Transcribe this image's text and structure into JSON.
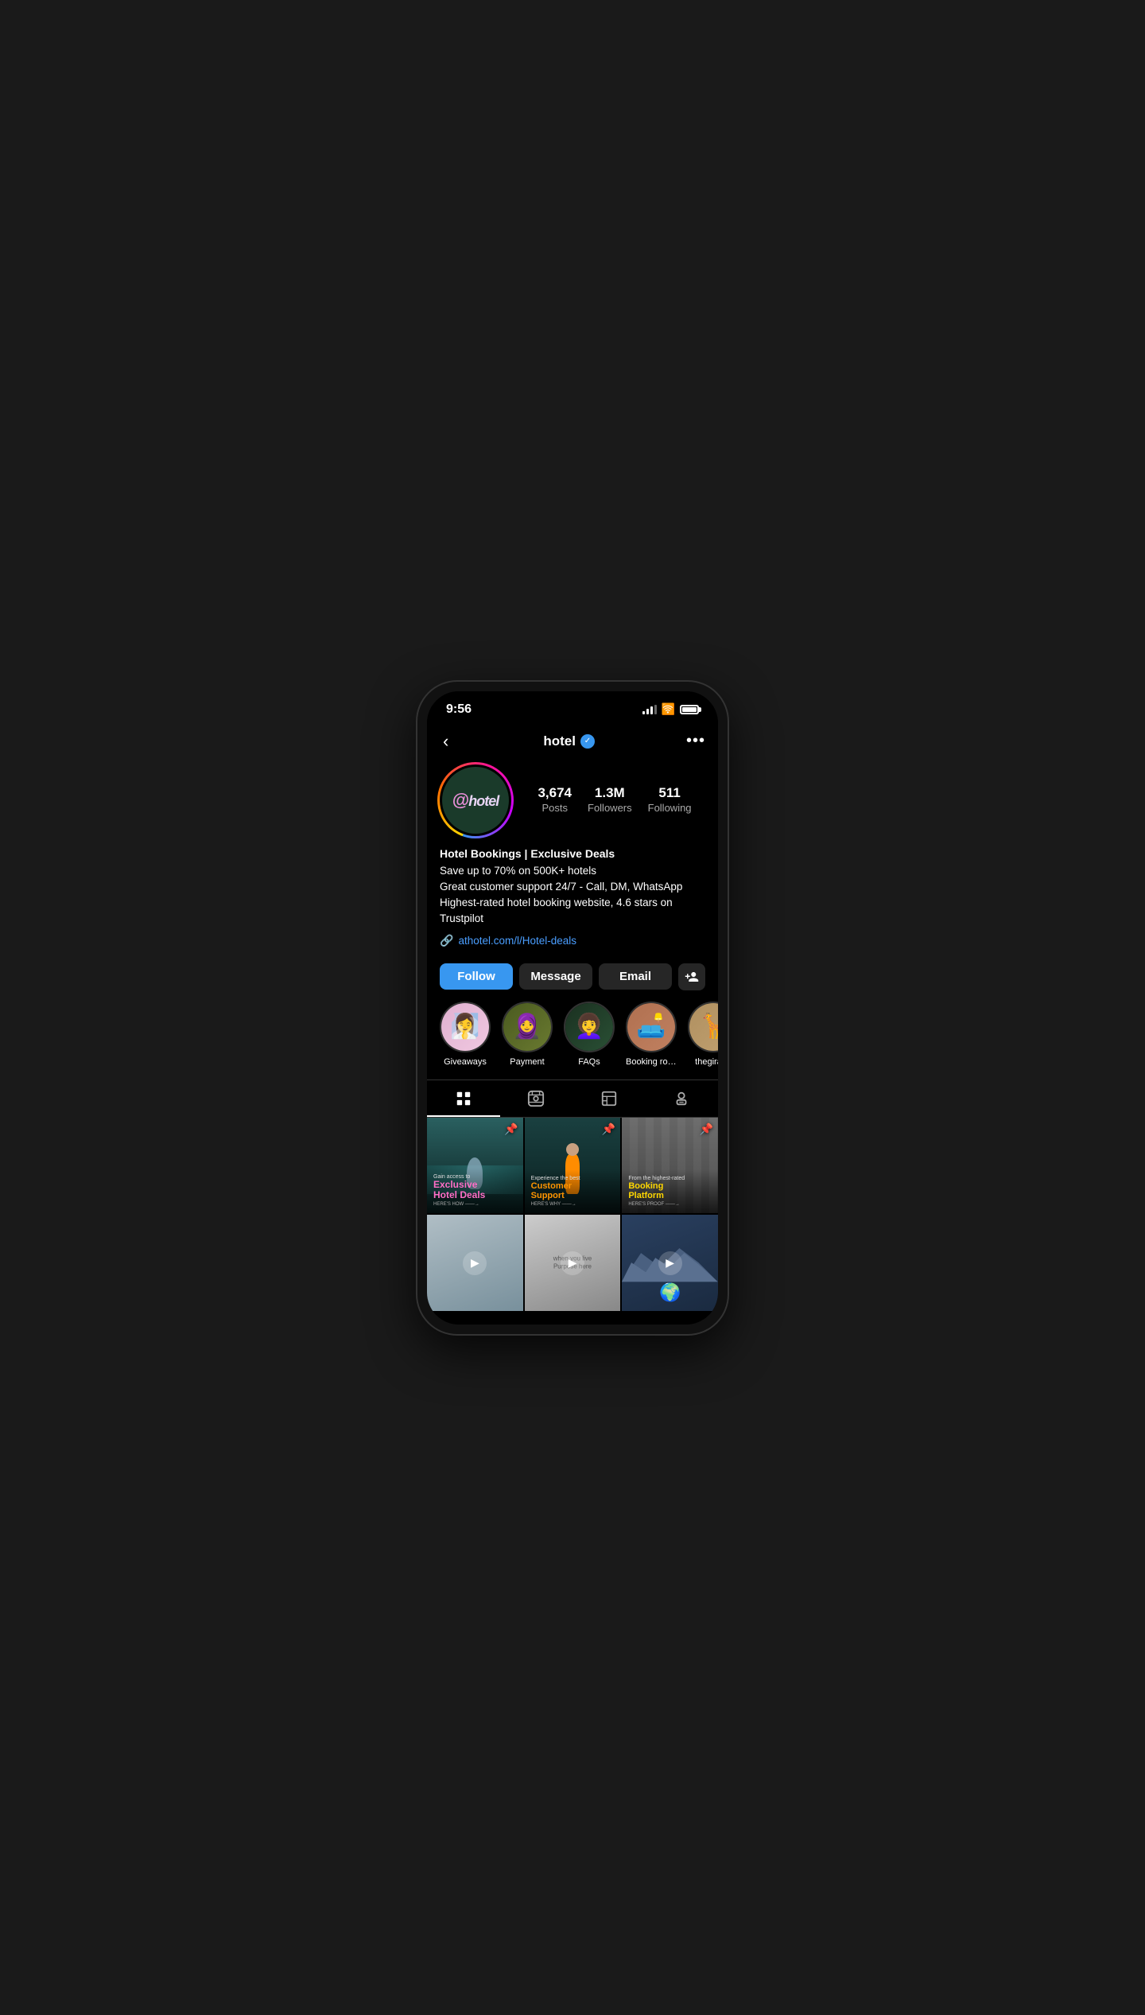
{
  "statusBar": {
    "time": "9:56"
  },
  "header": {
    "backLabel": "‹",
    "username": "hotel",
    "moreLabel": "•••"
  },
  "profile": {
    "avatarAlt": "@hotel",
    "stats": {
      "posts": {
        "value": "3,674",
        "label": "Posts"
      },
      "followers": {
        "value": "1.3M",
        "label": "Followers"
      },
      "following": {
        "value": "511",
        "label": "Following"
      }
    },
    "bioName": "Hotel Bookings | Exclusive Deals",
    "bioLines": [
      "Save up to 70% on 500K+ hotels",
      "Great customer support 24/7 - Call, DM, WhatsApp",
      "Highest-rated hotel booking website, 4.6 stars on Trustpilot"
    ],
    "link": "athotel.com/l/Hotel-deals"
  },
  "buttons": {
    "follow": "Follow",
    "message": "Message",
    "email": "Email"
  },
  "highlights": [
    {
      "label": "Giveaways",
      "emoji": "👩"
    },
    {
      "label": "Payment",
      "emoji": "👳"
    },
    {
      "label": "FAQs",
      "emoji": "👩"
    },
    {
      "label": "Booking roo...",
      "emoji": "🛏"
    },
    {
      "label": "thegiraffe",
      "emoji": "🦒"
    }
  ],
  "tabs": [
    {
      "label": "grid",
      "icon": "⊞",
      "active": true
    },
    {
      "label": "reels",
      "icon": "▶"
    },
    {
      "label": "tagged",
      "icon": "📋"
    },
    {
      "label": "profile-tag",
      "icon": "👤"
    }
  ],
  "grid": {
    "row1": [
      {
        "smallText": "Gain access to",
        "largeText": "Exclusive\nHotel Deals",
        "ctaText": "HERE'S HOW →",
        "pinned": true
      },
      {
        "smallText": "Experience the best",
        "largeText": "Customer\nSupport",
        "ctaText": "HERE'S WHY →",
        "pinned": true
      },
      {
        "smallText": "From the highest-rated",
        "largeText": "Booking\nPlatform",
        "ctaText": "HERE'S PROOF →",
        "pinned": true
      }
    ],
    "row2": [
      {
        "type": "video"
      },
      {
        "type": "video",
        "centerText": "when you live\nPurpose here"
      },
      {
        "type": "video"
      }
    ]
  }
}
